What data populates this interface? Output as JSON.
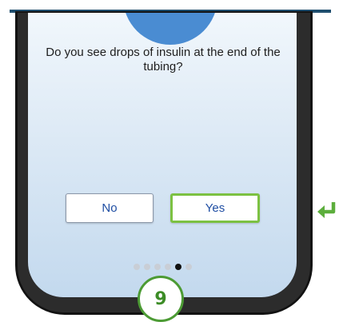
{
  "dialog": {
    "question": "Do you see drops of insulin at the end of the tubing?",
    "no_label": "No",
    "yes_label": "Yes"
  },
  "pagination": {
    "total_pages": 6,
    "current_page": 5
  },
  "step_badge": {
    "number": "9"
  },
  "icons": {
    "return": "return-arrow-icon"
  },
  "colors": {
    "accent_green": "#7cc142",
    "badge_green": "#4c9b34",
    "button_text_blue": "#1f4ea3",
    "header_circle_blue": "#4a8cd2",
    "top_bar": "#1f4e6e"
  }
}
